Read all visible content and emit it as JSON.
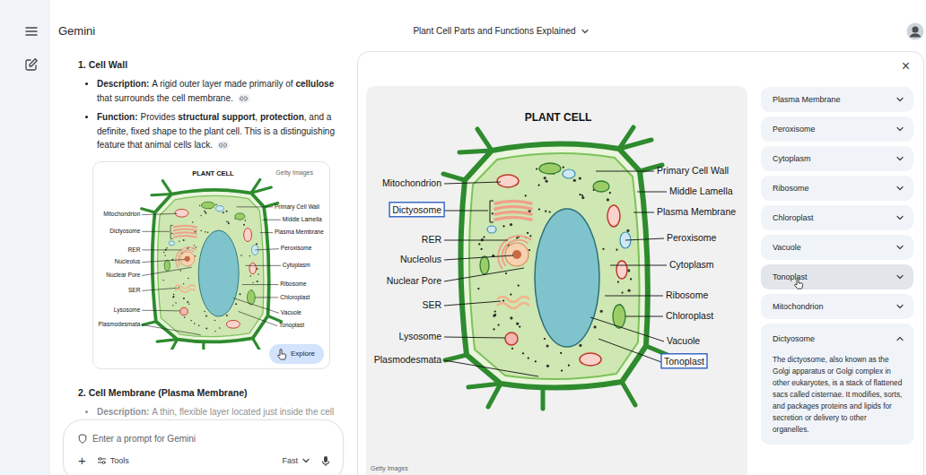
{
  "header": {
    "app_name": "Gemini",
    "conversation_title": "Plant Cell Parts and Functions Explained"
  },
  "chat": {
    "sections": [
      {
        "heading": "1. Cell Wall",
        "bullets": [
          {
            "label": "Description:",
            "has_source_link": true,
            "runs": [
              {
                "text": "A rigid outer layer made primarily of ",
                "bold": false
              },
              {
                "text": "cellulose",
                "bold": true
              },
              {
                "text": " that surrounds the cell membrane.",
                "bold": false
              }
            ]
          },
          {
            "label": "Function:",
            "has_source_link": true,
            "runs": [
              {
                "text": "Provides ",
                "bold": false
              },
              {
                "text": "structural support",
                "bold": true
              },
              {
                "text": ", ",
                "bold": false
              },
              {
                "text": "protection",
                "bold": true
              },
              {
                "text": ", and a definite, fixed shape to the plant cell. This is a distinguishing feature that animal cells lack.",
                "bold": false
              }
            ]
          }
        ],
        "image_card": {
          "source": "Getty Images",
          "button": "Explore"
        }
      },
      {
        "heading": "2. Cell Membrane (Plasma Membrane)",
        "bullets": [
          {
            "label": "Description:",
            "has_source_link": false,
            "runs": [
              {
                "text": "A thin, flexible layer located just inside the cell",
                "bold": false
              }
            ]
          }
        ]
      }
    ]
  },
  "input": {
    "placeholder": "Enter a prompt for Gemini",
    "add": "+",
    "tools": "Tools",
    "mode": "Fast"
  },
  "diagram": {
    "title": "PLANT CELL",
    "labels": [
      {
        "text": "Mitochondrion",
        "highlighted": false
      },
      {
        "text": "Dictyosome",
        "highlighted": true
      },
      {
        "text": "RER",
        "highlighted": false
      },
      {
        "text": "Nucleolus",
        "highlighted": false
      },
      {
        "text": "Nuclear Pore",
        "highlighted": false
      },
      {
        "text": "SER",
        "highlighted": false
      },
      {
        "text": "Lysosome",
        "highlighted": false
      },
      {
        "text": "Plasmodesmata",
        "highlighted": false
      },
      {
        "text": "Primary Cell Wall",
        "highlighted": false
      },
      {
        "text": "Middle Lamella",
        "highlighted": false
      },
      {
        "text": "Plasma Membrane",
        "highlighted": false
      },
      {
        "text": "Peroxisome",
        "highlighted": false
      },
      {
        "text": "Cytoplasm",
        "highlighted": false
      },
      {
        "text": "Ribosome",
        "highlighted": false
      },
      {
        "text": "Chloroplast",
        "highlighted": false
      },
      {
        "text": "Vacuole",
        "highlighted": false
      },
      {
        "text": "Tonoplast",
        "highlighted": true
      }
    ]
  },
  "viewer": {
    "close": "×",
    "image_source": "Getty Images",
    "parts": [
      {
        "label": "Plasma Membrane",
        "expanded": false,
        "hovered": false
      },
      {
        "label": "Peroxisome",
        "expanded": false,
        "hovered": false
      },
      {
        "label": "Cytoplasm",
        "expanded": false,
        "hovered": false
      },
      {
        "label": "Ribosome",
        "expanded": false,
        "hovered": false
      },
      {
        "label": "Chloroplast",
        "expanded": false,
        "hovered": false
      },
      {
        "label": "Vacuole",
        "expanded": false,
        "hovered": false
      },
      {
        "label": "Tonoplast",
        "expanded": false,
        "hovered": true
      },
      {
        "label": "Mitochondrion",
        "expanded": false,
        "hovered": false
      },
      {
        "label": "Dictyosome",
        "expanded": true,
        "hovered": false,
        "description": "The dictyosome, also known as the Golgi apparatus or Golgi complex in other eukaryotes, is a stack of flattened sacs called cisternae. It modifies, sorts, and packages proteins and lipids for secretion or delivery to other organelles."
      }
    ]
  }
}
